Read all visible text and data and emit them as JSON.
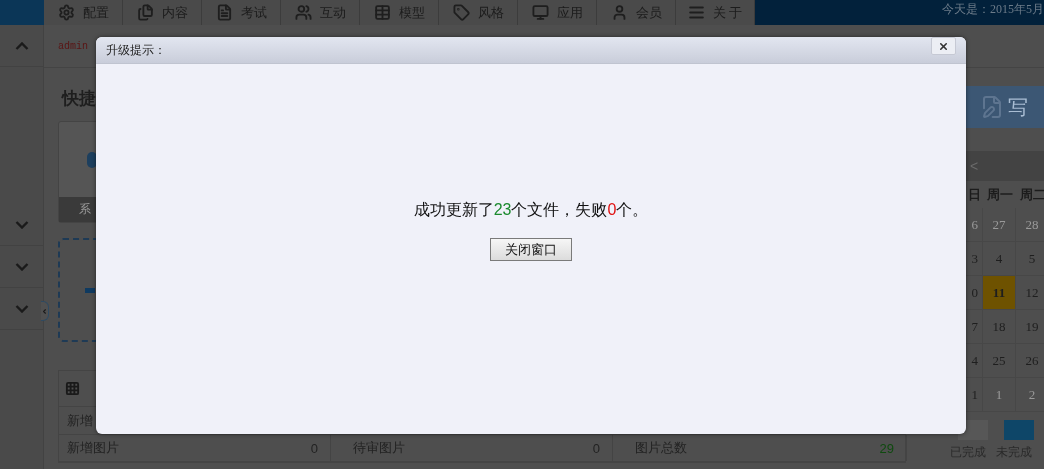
{
  "top_bar": {
    "nav_tabs": [
      {
        "label": "配置"
      },
      {
        "label": "内容"
      },
      {
        "label": "考试"
      },
      {
        "label": "互动"
      },
      {
        "label": "模型"
      },
      {
        "label": "风格"
      },
      {
        "label": "应用"
      },
      {
        "label": "会员"
      },
      {
        "label": "关 于"
      }
    ],
    "date_text": "今天是：2015年5月"
  },
  "sidebar": {
    "items": [
      {
        "expanded": true
      },
      {
        "expanded": false
      },
      {
        "expanded": false
      },
      {
        "expanded": false
      }
    ]
  },
  "breadcrumb": {
    "user": "admin"
  },
  "quick": {
    "title": "快捷",
    "card_label": "系"
  },
  "stats": {
    "first_row_label": "新增",
    "cells": [
      {
        "label": "新增图片",
        "value": "0",
        "highlight": false
      },
      {
        "label": "待审图片",
        "value": "0",
        "highlight": false
      },
      {
        "label": "图片总数",
        "value": "29",
        "highlight": true
      }
    ]
  },
  "write_button": {
    "label": "写"
  },
  "calendar": {
    "prev": "<",
    "weekdays": [
      "日",
      "周一",
      "周二"
    ],
    "weeks": [
      [
        {
          "day": "6",
          "muted": true,
          "selected": false
        },
        {
          "day": "27",
          "muted": true,
          "selected": false
        },
        {
          "day": "28",
          "muted": true,
          "selected": false
        }
      ],
      [
        {
          "day": "3",
          "muted": false,
          "selected": false
        },
        {
          "day": "4",
          "muted": false,
          "selected": false
        },
        {
          "day": "5",
          "muted": false,
          "selected": false
        }
      ],
      [
        {
          "day": "0",
          "muted": false,
          "selected": false
        },
        {
          "day": "11",
          "muted": false,
          "selected": true
        },
        {
          "day": "12",
          "muted": false,
          "selected": false
        }
      ],
      [
        {
          "day": "7",
          "muted": false,
          "selected": false
        },
        {
          "day": "18",
          "muted": false,
          "selected": false
        },
        {
          "day": "19",
          "muted": false,
          "selected": false
        }
      ],
      [
        {
          "day": "4",
          "muted": false,
          "selected": false
        },
        {
          "day": "25",
          "muted": false,
          "selected": false
        },
        {
          "day": "26",
          "muted": false,
          "selected": false
        }
      ],
      [
        {
          "day": "1",
          "muted": false,
          "selected": false
        },
        {
          "day": "1",
          "muted": true,
          "selected": false
        },
        {
          "day": "2",
          "muted": true,
          "selected": false
        }
      ]
    ],
    "legend": [
      {
        "label": "已完成",
        "color": "#575757"
      },
      {
        "label": "未完成",
        "color": "#0e4668"
      }
    ]
  },
  "dialog": {
    "title": "升级提示：",
    "message": [
      {
        "text": "成功更新了",
        "kind": "plain"
      },
      {
        "text": "23",
        "kind": "success"
      },
      {
        "text": "个文件，失败",
        "kind": "plain"
      },
      {
        "text": "0",
        "kind": "failure"
      },
      {
        "text": "个。",
        "kind": "plain"
      }
    ],
    "button": "关闭窗口"
  }
}
